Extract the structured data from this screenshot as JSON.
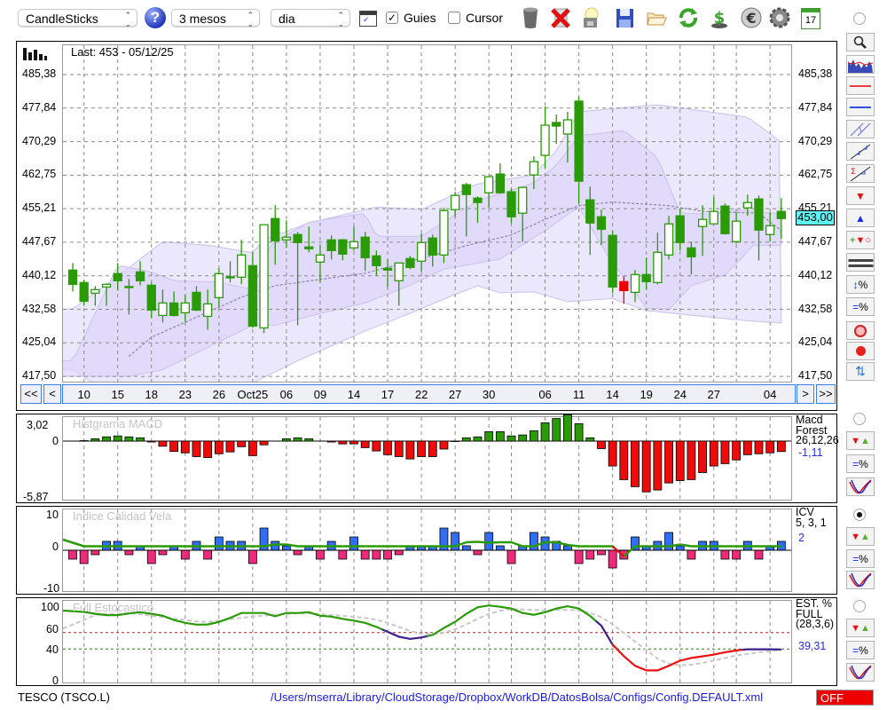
{
  "toolbar": {
    "chart_type": "CandleSticks",
    "period": "3 mesos",
    "interval": "dia",
    "guides_label": "Guies",
    "guides_checked": true,
    "cursor_label": "Cursor",
    "cursor_checked": false,
    "help": "?",
    "calendar_day": "17"
  },
  "main": {
    "last_label": "Last: 453 - 05/12/25",
    "y_ticks": [
      "485,38",
      "477,84",
      "470,29",
      "462,75",
      "455,21",
      "447,67",
      "440,12",
      "432,58",
      "425,04",
      "417,50"
    ],
    "y_tick_values": [
      485.38,
      477.84,
      470.29,
      462.75,
      455.21,
      447.67,
      440.12,
      432.58,
      425.04,
      417.5
    ],
    "current_price": "453,00",
    "nav": {
      "first": "<<",
      "prev": "<",
      "next": ">",
      "last": ">>"
    },
    "x_labels": [
      {
        "label": "10",
        "index": 1
      },
      {
        "label": "15",
        "index": 4
      },
      {
        "label": "18",
        "index": 7
      },
      {
        "label": "23",
        "index": 10
      },
      {
        "label": "26",
        "index": 13
      },
      {
        "label": "Oct25",
        "index": 16
      },
      {
        "label": "06",
        "index": 19
      },
      {
        "label": "09",
        "index": 22
      },
      {
        "label": "14",
        "index": 25
      },
      {
        "label": "17",
        "index": 28
      },
      {
        "label": "22",
        "index": 31
      },
      {
        "label": "27",
        "index": 34
      },
      {
        "label": "30",
        "index": 37
      },
      {
        "label": "06",
        "index": 42
      },
      {
        "label": "11",
        "index": 45
      },
      {
        "label": "14",
        "index": 48
      },
      {
        "label": "19",
        "index": 51
      },
      {
        "label": "24",
        "index": 54
      },
      {
        "label": "27",
        "index": 57
      },
      {
        "label": "04",
        "index": 62
      }
    ],
    "grid_indices": [
      1,
      4,
      7,
      10,
      13,
      16,
      19,
      22,
      25,
      28,
      31,
      34,
      37,
      39,
      42,
      45,
      48,
      51,
      54,
      57,
      59,
      62
    ]
  },
  "macd": {
    "title": "Histgrama MACD",
    "legend": "Macd\nForest\n26,12,26",
    "value": "-1,11",
    "y_ticks": [
      "3,02",
      "0",
      "-5,87"
    ]
  },
  "icv": {
    "title": "Indice Calidad Vela",
    "legend": "ICV\n5, 3, 1",
    "value": "2",
    "y_ticks": [
      "10",
      "0",
      "-10"
    ]
  },
  "stoch": {
    "title": "Full Estocastico",
    "legend": "EST. %\nFULL\n(28,3,6)",
    "value": "39,31",
    "y_ticks": [
      "100",
      "60",
      "40",
      "0"
    ]
  },
  "status": {
    "symbol": "TESCO (TSCO.L)",
    "path": "/Users/mserra/Library/CloudStorage/Dropbox/WorkDB/DatosBolsa/Configs/Config.DEFAULT.xml",
    "toggle": "OFF"
  },
  "colors": {
    "up_body": "#ffffff",
    "candle": "#2a9a06",
    "highlight_candle": "#ee0000",
    "macd_pos": "#2a9a06",
    "macd_neg": "#ee0b0b",
    "icv_pos": "#2f6ef5",
    "icv_neg": "#ee2a7b",
    "price_tag": "#5ff5f5",
    "band_outer": "#ebe7fd",
    "band_inner": "#ddd5fa",
    "off": "#ee0000",
    "path_link": "#1a1ae8"
  },
  "chart_data": [
    {
      "type": "candlestick",
      "title": "TESCO (TSCO.L)",
      "ylim": [
        417.5,
        485.38
      ],
      "highlight_indices": [
        49
      ],
      "ohlc": [
        [
          441.4,
          443.0,
          436.6,
          438.2
        ],
        [
          438.6,
          439.2,
          433.4,
          434.4
        ],
        [
          436.2,
          437.8,
          433.4,
          437.0
        ],
        [
          437.6,
          438.4,
          433.4,
          438.2
        ],
        [
          440.6,
          443.0,
          436.8,
          439.0
        ],
        [
          437.7,
          439.4,
          431.4,
          437.5
        ],
        [
          441.0,
          443.4,
          438.0,
          439.0
        ],
        [
          438.0,
          438.6,
          430.6,
          432.4
        ],
        [
          431.2,
          437.0,
          429.6,
          434.0
        ],
        [
          434.0,
          436.6,
          431.0,
          431.2
        ],
        [
          431.8,
          435.8,
          429.8,
          434.0
        ],
        [
          436.4,
          437.8,
          432.2,
          432.4
        ],
        [
          431.0,
          437.0,
          428.0,
          433.8
        ],
        [
          435.2,
          441.8,
          433.2,
          440.6
        ],
        [
          439.9,
          443.4,
          438.6,
          439.7
        ],
        [
          439.8,
          448.2,
          438.2,
          444.8
        ],
        [
          442.4,
          445.4,
          428.4,
          428.8
        ],
        [
          428.4,
          451.6,
          427.2,
          451.6
        ],
        [
          453.0,
          456.0,
          442.6,
          448.0
        ],
        [
          448.2,
          452.6,
          446.4,
          448.8
        ],
        [
          449.4,
          450.0,
          429.0,
          447.6
        ],
        [
          446.6,
          451.2,
          445.4,
          446.2
        ],
        [
          443.2,
          447.0,
          438.6,
          444.8
        ],
        [
          448.2,
          449.2,
          443.8,
          445.8
        ],
        [
          448.2,
          448.4,
          443.6,
          445.0
        ],
        [
          446.4,
          451.2,
          445.8,
          447.8
        ],
        [
          448.8,
          450.0,
          441.2,
          444.2
        ],
        [
          444.6,
          445.8,
          440.2,
          442.4
        ],
        [
          441.8,
          443.8,
          437.6,
          441.4
        ],
        [
          439.0,
          443.0,
          433.4,
          443.0
        ],
        [
          444.0,
          444.6,
          441.6,
          442.0
        ],
        [
          443.4,
          449.6,
          441.0,
          447.6
        ],
        [
          448.6,
          449.4,
          442.2,
          444.8
        ],
        [
          444.8,
          455.4,
          443.0,
          454.8
        ],
        [
          455.0,
          459.0,
          453.4,
          458.2
        ],
        [
          460.6,
          461.0,
          449.0,
          458.4
        ],
        [
          457.6,
          458.0,
          452.0,
          456.6
        ],
        [
          458.8,
          462.4,
          455.4,
          462.4
        ],
        [
          463.0,
          465.4,
          458.6,
          458.8
        ],
        [
          459.0,
          459.8,
          452.0,
          453.4
        ],
        [
          454.2,
          460.0,
          447.8,
          460.0
        ],
        [
          462.8,
          467.0,
          459.6,
          465.8
        ],
        [
          467.2,
          478.2,
          464.4,
          474.0
        ],
        [
          474.6,
          476.4,
          469.8,
          473.8
        ],
        [
          472.0,
          477.0,
          465.6,
          475.2
        ],
        [
          479.4,
          480.4,
          456.4,
          461.4
        ],
        [
          457.2,
          460.2,
          444.8,
          452.0
        ],
        [
          453.4,
          455.0,
          447.0,
          450.6
        ],
        [
          449.2,
          450.2,
          436.2,
          437.6
        ],
        [
          438.8,
          440.0,
          433.8,
          436.8
        ],
        [
          436.4,
          441.4,
          434.2,
          440.4
        ],
        [
          440.4,
          444.2,
          437.0,
          438.8
        ],
        [
          438.6,
          449.8,
          438.2,
          445.4
        ],
        [
          444.8,
          453.6,
          443.8,
          451.8
        ],
        [
          453.6,
          455.2,
          445.8,
          447.6
        ],
        [
          446.4,
          447.8,
          440.4,
          444.4
        ],
        [
          451.2,
          456.0,
          444.6,
          452.8
        ],
        [
          451.8,
          457.8,
          451.8,
          454.6
        ],
        [
          455.8,
          456.4,
          449.4,
          449.6
        ],
        [
          447.8,
          454.4,
          447.4,
          452.4
        ],
        [
          455.4,
          458.4,
          453.6,
          456.6
        ],
        [
          457.4,
          458.2,
          443.6,
          450.4
        ],
        [
          449.4,
          454.4,
          447.8,
          451.4
        ],
        [
          454.6,
          457.6,
          448.4,
          453.0
        ]
      ],
      "outer_band_upper": [
        [
          0,
          432.6
        ],
        [
          4,
          440
        ],
        [
          8,
          447.8
        ],
        [
          12,
          447
        ],
        [
          16,
          445.3
        ],
        [
          17,
          448.2
        ],
        [
          21,
          452
        ],
        [
          27,
          455.6
        ],
        [
          31,
          455
        ],
        [
          36,
          460.8
        ],
        [
          41,
          462.8
        ],
        [
          43,
          468.2
        ],
        [
          45,
          477
        ],
        [
          52,
          478.6
        ],
        [
          60,
          475.8
        ],
        [
          63,
          470.2
        ]
      ],
      "outer_band_lower": [
        [
          0,
          419
        ],
        [
          3,
          414
        ],
        [
          10,
          413
        ],
        [
          16,
          416
        ],
        [
          20,
          421
        ],
        [
          26,
          427.7
        ],
        [
          30,
          431.7
        ],
        [
          33,
          434.9
        ],
        [
          36,
          437.9
        ],
        [
          38,
          436.3
        ],
        [
          41,
          436.5
        ],
        [
          44,
          434.3
        ],
        [
          48,
          435
        ],
        [
          51,
          432.3
        ],
        [
          56,
          431
        ],
        [
          60,
          430
        ],
        [
          63,
          429.5
        ]
      ],
      "inner_band_upper": [
        [
          0,
          421
        ],
        [
          4,
          442.5
        ],
        [
          7,
          441
        ],
        [
          9,
          439
        ],
        [
          13,
          438.7
        ],
        [
          16,
          437
        ],
        [
          17.5,
          447
        ],
        [
          21,
          452.2
        ],
        [
          26,
          454.2
        ],
        [
          27,
          449
        ],
        [
          31,
          449
        ],
        [
          36,
          457
        ],
        [
          41,
          461
        ],
        [
          43,
          465
        ],
        [
          45,
          471.6
        ],
        [
          49,
          472.8
        ],
        [
          52,
          466.7
        ],
        [
          54,
          454.2
        ],
        [
          57,
          454
        ],
        [
          59,
          455
        ],
        [
          63,
          454
        ]
      ],
      "inner_band_lower": [
        [
          0,
          417.5
        ],
        [
          5,
          417.5
        ],
        [
          8,
          419
        ],
        [
          12,
          424
        ],
        [
          16,
          429
        ],
        [
          18,
          429
        ],
        [
          21,
          431
        ],
        [
          26,
          434
        ],
        [
          30,
          438
        ],
        [
          33,
          441.6
        ],
        [
          38,
          443.9
        ],
        [
          42,
          450.3
        ],
        [
          45,
          455.6
        ],
        [
          47.5,
          444.9
        ],
        [
          51,
          432.9
        ],
        [
          53,
          432.5
        ],
        [
          55,
          437.9
        ],
        [
          58,
          440.3
        ],
        [
          60.5,
          446.9
        ],
        [
          63,
          447
        ]
      ],
      "moving_average": [
        [
          5,
          422
        ],
        [
          7,
          426.3
        ],
        [
          15,
          435.3
        ],
        [
          18,
          437.9
        ],
        [
          26,
          440.7
        ],
        [
          32,
          444.7
        ],
        [
          35,
          446.9
        ],
        [
          39,
          449.3
        ],
        [
          42,
          452.8
        ],
        [
          45,
          455.9
        ],
        [
          48,
          456.7
        ],
        [
          53,
          455.9
        ],
        [
          56,
          454.6
        ],
        [
          61,
          454.2
        ],
        [
          63,
          450.3
        ]
      ]
    },
    {
      "type": "bar",
      "title": "Histgrama MACD",
      "ylim": [
        -5.87,
        3.02
      ],
      "values": [
        0,
        0.05,
        0.25,
        0.45,
        0.55,
        0.45,
        0.35,
        -0.1,
        -0.55,
        -1.1,
        -1.25,
        -1.65,
        -1.75,
        -1.35,
        -1.15,
        -0.6,
        -1.55,
        -0.4,
        0,
        0.25,
        0.35,
        0.25,
        0,
        -0.1,
        -0.3,
        -0.3,
        -0.7,
        -1.05,
        -1.45,
        -1.65,
        -1.9,
        -1.65,
        -1.65,
        -0.85,
        -0.05,
        0.35,
        0.45,
        1.0,
        1.0,
        0.55,
        0.65,
        1.1,
        1.95,
        2.4,
        2.8,
        1.85,
        0.35,
        -0.8,
        -2.65,
        -4.1,
        -4.85,
        -5.4,
        -5.2,
        -4.45,
        -4.2,
        -4.1,
        -3.35,
        -2.65,
        -2.4,
        -2.0,
        -1.45,
        -1.35,
        -1.25,
        -1.11
      ]
    },
    {
      "type": "bar",
      "title": "Indice Calidad Vela",
      "ylim": [
        -10,
        10
      ],
      "values": [
        -2,
        -3,
        -1,
        2,
        2,
        -1,
        1,
        -3,
        -1,
        1,
        -2,
        2,
        -2,
        3,
        2,
        2,
        -3,
        5,
        2,
        1,
        -1,
        1,
        -2,
        2,
        -2,
        3,
        -2,
        -2,
        -2,
        -1,
        1,
        1,
        1,
        5,
        4,
        1,
        -1,
        4,
        1,
        -3,
        1,
        4,
        3,
        2,
        1,
        -3,
        -2,
        -1,
        -4,
        -2,
        3,
        1,
        2,
        4,
        1,
        -2,
        2,
        2,
        -2,
        -2,
        2,
        -2,
        1,
        2
      ],
      "signal": [
        2.4,
        0.9,
        0.9,
        0.9,
        0.9,
        0.9,
        0.9,
        0.9,
        0.9,
        0.9,
        0.9,
        0.9,
        0.9,
        0.9,
        0.9,
        0.9,
        0.9,
        0.9,
        1.3,
        1.3,
        0.9,
        0.9,
        0.9,
        0.9,
        0.9,
        0.9,
        0.9,
        0.9,
        0.9,
        0.9,
        0.9,
        0.9,
        0.9,
        0.9,
        0.9,
        1.8,
        1.9,
        1.7,
        1.8,
        1.8,
        0.9,
        0.9,
        1.8,
        1.8,
        1.2,
        0.9,
        0.9,
        0.9,
        0.9,
        -1.4,
        0.9,
        0.9,
        0.9,
        0.9,
        1.3,
        0.9,
        0.9,
        0.9,
        0.9,
        0.9,
        0.9,
        0.9,
        0.9,
        0.9
      ],
      "signal_down_segments": [
        [
          48,
          49
        ]
      ]
    },
    {
      "type": "line",
      "title": "Full Estocastico",
      "ylim": [
        0,
        100
      ],
      "reference_lines": [
        60,
        40
      ],
      "k": [
        87,
        85.3,
        83,
        81.4,
        81.4,
        83.5,
        85,
        83,
        80.7,
        75.4,
        72,
        69.8,
        70,
        73,
        78,
        84,
        84,
        84,
        80,
        84,
        84,
        85,
        80.7,
        79.6,
        76.8,
        74.7,
        72,
        67,
        61,
        55,
        52.3,
        54,
        57.2,
        65.6,
        73.3,
        83,
        91,
        93.3,
        91.6,
        89.5,
        84,
        81.8,
        85,
        89.5,
        92.3,
        89.5,
        80.4,
        68.4,
        45.3,
        31.2,
        19.3,
        13.7,
        13.7,
        19.3,
        25.6,
        29,
        31,
        33,
        36,
        38.2,
        39.6,
        39.6,
        39.6,
        39.31
      ],
      "d": [
        65,
        75.4,
        81.8,
        83,
        83,
        84,
        82.5,
        80.7,
        79,
        77.2,
        75.4,
        73.7,
        73,
        74.7,
        76.5,
        78,
        79.6,
        81,
        81.8,
        82.8,
        83.5,
        83.5,
        82.5,
        81.4,
        80.7,
        79.3,
        78,
        75.8,
        72,
        67,
        62,
        58.6,
        58,
        59.6,
        64.2,
        70,
        77,
        83,
        86.7,
        88.8,
        88.4,
        87.7,
        87.4,
        87.7,
        87.7,
        87.4,
        84,
        79,
        70,
        59.6,
        49,
        38.6,
        28,
        22,
        20,
        20.7,
        22.8,
        25.6,
        29,
        32,
        34,
        35.8,
        37.5,
        38.9
      ],
      "k_segments": [
        {
          "from": 0,
          "to": 27.5,
          "trend": "up"
        },
        {
          "from": 27.5,
          "to": 31.5,
          "trend": "weak"
        },
        {
          "from": 31.5,
          "to": 46.5,
          "trend": "up"
        },
        {
          "from": 46.5,
          "to": 48,
          "trend": "weak"
        },
        {
          "from": 48,
          "to": 59.5,
          "trend": "down"
        },
        {
          "from": 59.5,
          "to": 63,
          "trend": "weak"
        }
      ]
    }
  ]
}
